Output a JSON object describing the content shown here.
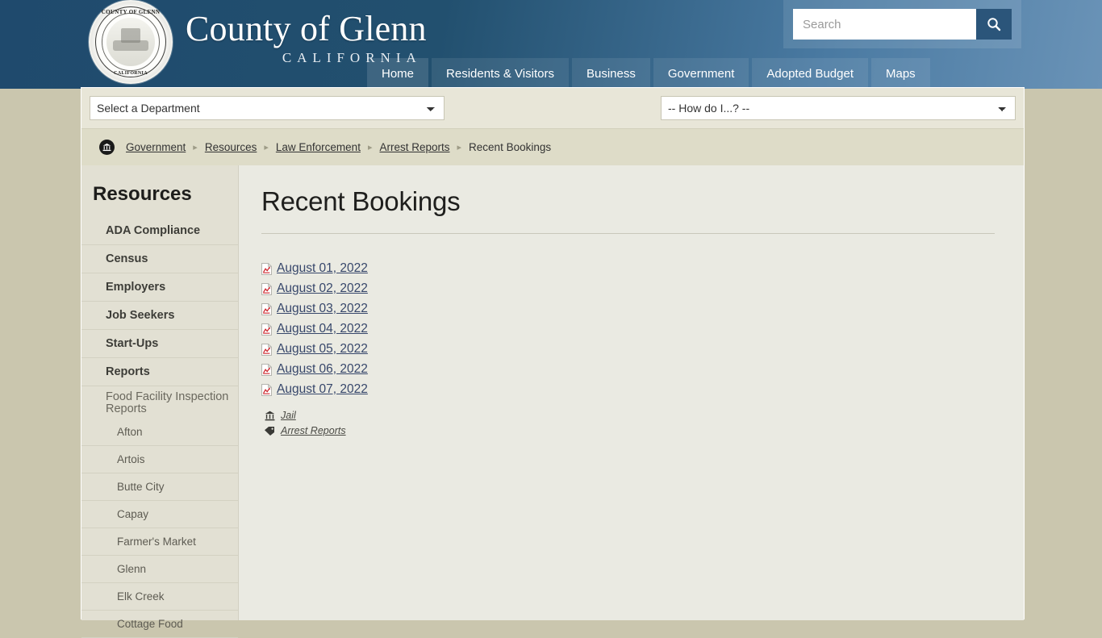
{
  "header": {
    "site_title": "County of Glenn",
    "site_subtitle": "CALIFORNIA",
    "seal_top_text": "COUNTY OF GLENN",
    "seal_bottom_text": "CALIFORNIA",
    "colors": {
      "header_dark": "#1f4a6d",
      "header_light": "#6a93b7",
      "accent": "#2b557a"
    }
  },
  "search": {
    "placeholder": "Search",
    "value": "",
    "icon": "search-icon"
  },
  "nav": {
    "items": [
      {
        "label": "Home",
        "active": true
      },
      {
        "label": "Residents & Visitors",
        "active": false
      },
      {
        "label": "Business",
        "active": false
      },
      {
        "label": "Government",
        "active": false
      },
      {
        "label": "Adopted Budget",
        "active": false
      },
      {
        "label": "Maps",
        "active": false
      }
    ]
  },
  "tools": {
    "department_select": "Select a Department",
    "howdoi_select": "-- How do I...? --"
  },
  "breadcrumb": {
    "home_icon": "bank-icon",
    "items": [
      {
        "label": "Government",
        "current": false
      },
      {
        "label": "Resources",
        "current": false
      },
      {
        "label": "Law Enforcement",
        "current": false
      },
      {
        "label": "Arrest Reports",
        "current": false
      },
      {
        "label": "Recent Bookings",
        "current": true
      }
    ],
    "separator": "▸"
  },
  "sidebar": {
    "heading": "Resources",
    "items": [
      {
        "label": "ADA Compliance",
        "type": "bold"
      },
      {
        "label": "Census",
        "type": "bold"
      },
      {
        "label": "Employers",
        "type": "bold"
      },
      {
        "label": "Job Seekers",
        "type": "bold"
      },
      {
        "label": "Start-Ups",
        "type": "bold"
      },
      {
        "label": "Reports",
        "type": "bold"
      },
      {
        "label": "Food Facility Inspection Reports",
        "type": "plain"
      },
      {
        "label": "Afton",
        "type": "sub"
      },
      {
        "label": "Artois",
        "type": "sub"
      },
      {
        "label": "Butte City",
        "type": "sub"
      },
      {
        "label": "Capay",
        "type": "sub"
      },
      {
        "label": "Farmer's Market",
        "type": "sub"
      },
      {
        "label": "Glenn",
        "type": "sub"
      },
      {
        "label": "Elk Creek",
        "type": "sub"
      },
      {
        "label": "Cottage Food",
        "type": "sub"
      }
    ]
  },
  "main": {
    "title": "Recent Bookings",
    "documents": [
      {
        "label": "August 01, 2022",
        "icon": "pdf-icon"
      },
      {
        "label": "August 02, 2022",
        "icon": "pdf-icon"
      },
      {
        "label": "August 03, 2022",
        "icon": "pdf-icon"
      },
      {
        "label": "August 04, 2022",
        "icon": "pdf-icon"
      },
      {
        "label": "August 05, 2022",
        "icon": "pdf-icon"
      },
      {
        "label": "August 06, 2022",
        "icon": "pdf-icon"
      },
      {
        "label": "August 07, 2022",
        "icon": "pdf-icon"
      }
    ],
    "meta": [
      {
        "label": "Jail",
        "icon": "bank-icon"
      },
      {
        "label": "Arrest Reports",
        "icon": "tag-icon"
      }
    ]
  }
}
